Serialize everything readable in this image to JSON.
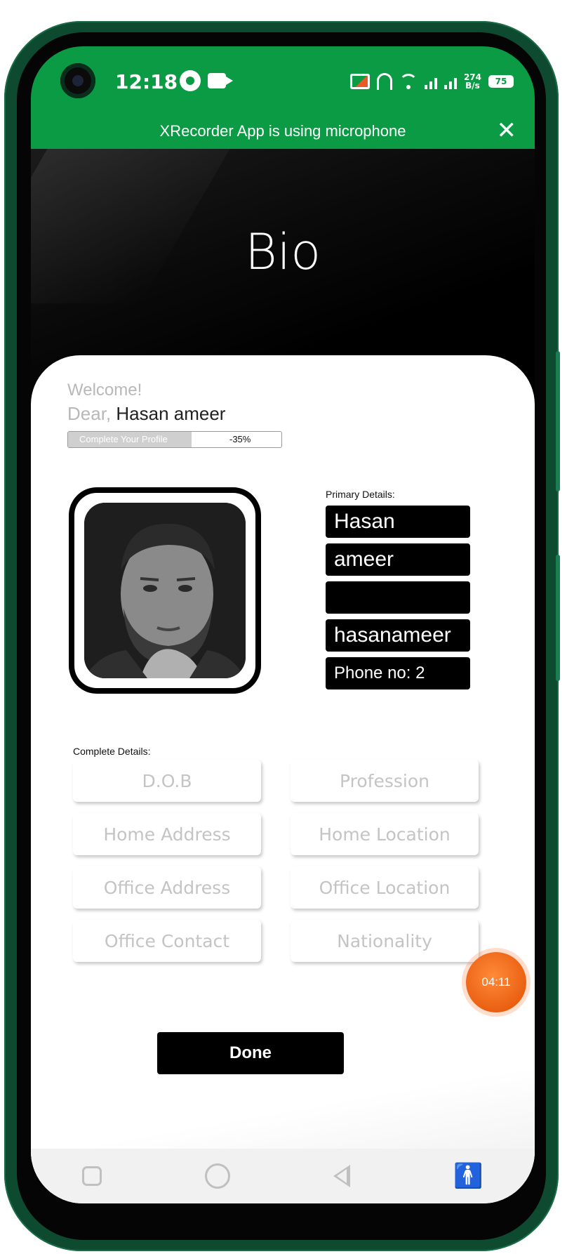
{
  "status_bar": {
    "time": "12:18",
    "network_speed_value": "274",
    "network_speed_unit": "B/s",
    "battery": "75"
  },
  "notification_banner": {
    "text": "XRecorder App is using microphone",
    "close_symbol": "✕"
  },
  "header": {
    "title": "Bio"
  },
  "greeting": {
    "welcome": "Welcome!",
    "dear_prefix": "Dear, ",
    "user_name": "Hasan ameer"
  },
  "profile_progress": {
    "label": "Complete Your Profile",
    "value_text": "-35%",
    "fill_fraction": 0.58
  },
  "primary_details": {
    "label": "Primary Details:",
    "first_name": "Hasan",
    "last_name": "ameer",
    "email_redacted": "",
    "username": "hasanameer",
    "phone": "Phone no: 2"
  },
  "complete_details": {
    "label": "Complete Details:",
    "buttons": [
      "D.O.B",
      "Profession",
      "Home Address",
      "Home Location",
      "Office Address",
      "Office Location",
      "Office Contact",
      "Nationality"
    ]
  },
  "recorder_timer": "04:11",
  "actions": {
    "done": "Done"
  },
  "nav": {
    "accessibility_symbol": "🚹"
  },
  "colors": {
    "status_bar": "#0a9b44",
    "frame": "#0d4a30",
    "timer": "#e24e00"
  }
}
